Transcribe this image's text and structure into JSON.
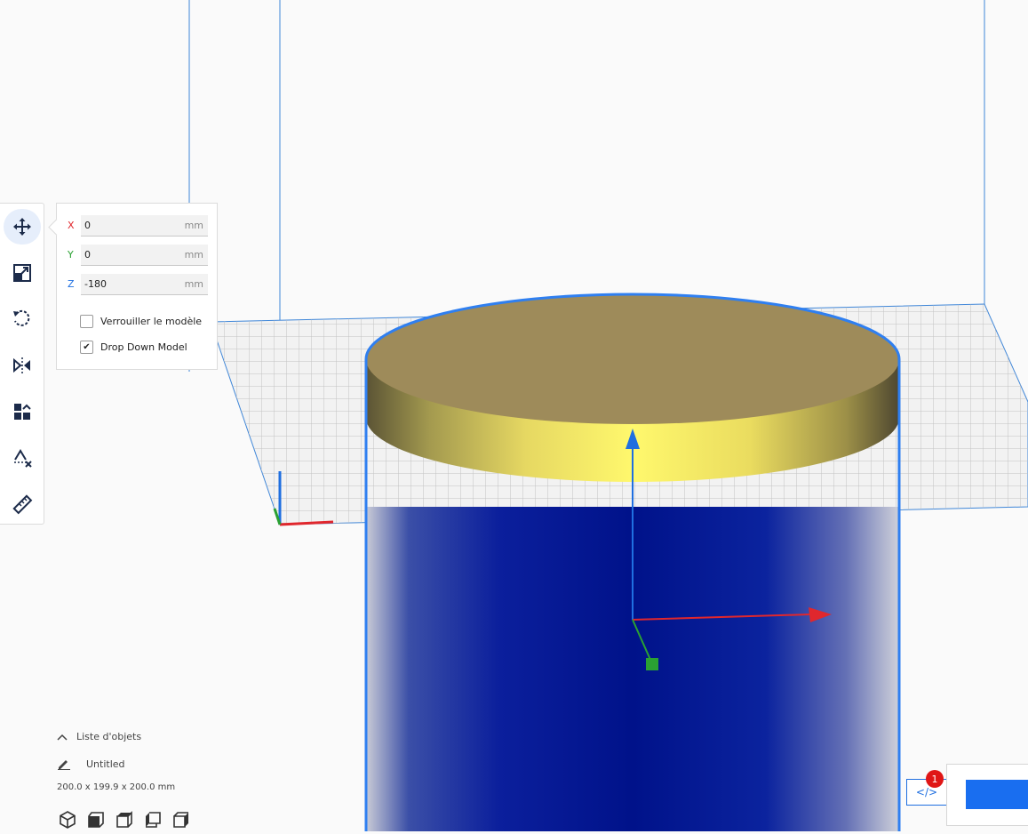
{
  "colors": {
    "accent": "#196ef0",
    "axis_x": "#e0272d",
    "axis_y": "#2aa132",
    "axis_z": "#1f6fe0",
    "model_top": "#a08c5a",
    "model_side": "#f6ef6a",
    "model_below": "#0a1f9a",
    "badge": "#e01616"
  },
  "toolbar": {
    "tools": [
      {
        "name": "move",
        "icon": "move-arrows-icon",
        "active": true
      },
      {
        "name": "scale",
        "icon": "scale-icon"
      },
      {
        "name": "rotate",
        "icon": "rotate-icon"
      },
      {
        "name": "mirror",
        "icon": "mirror-icon"
      },
      {
        "name": "per-model-settings",
        "icon": "per-model-settings-icon"
      },
      {
        "name": "support-blocker",
        "icon": "support-blocker-icon"
      },
      {
        "name": "measure",
        "icon": "ruler-icon"
      }
    ]
  },
  "move_panel": {
    "x": {
      "label": "X",
      "value": "0",
      "unit": "mm"
    },
    "y": {
      "label": "Y",
      "value": "0",
      "unit": "mm"
    },
    "z": {
      "label": "Z",
      "value": "-180",
      "unit": "mm"
    },
    "lock_model": {
      "label": "Verrouiller le modèle",
      "checked": false
    },
    "drop_down": {
      "label": "Drop Down Model",
      "checked": true,
      "check_glyph": "✔"
    }
  },
  "object_list": {
    "header": "Liste d'objets",
    "object_name": "Untitled",
    "dimensions": "200.0 x 199.9 x 200.0 mm"
  },
  "notifications": {
    "count": "1",
    "code_glyph": "</>"
  }
}
